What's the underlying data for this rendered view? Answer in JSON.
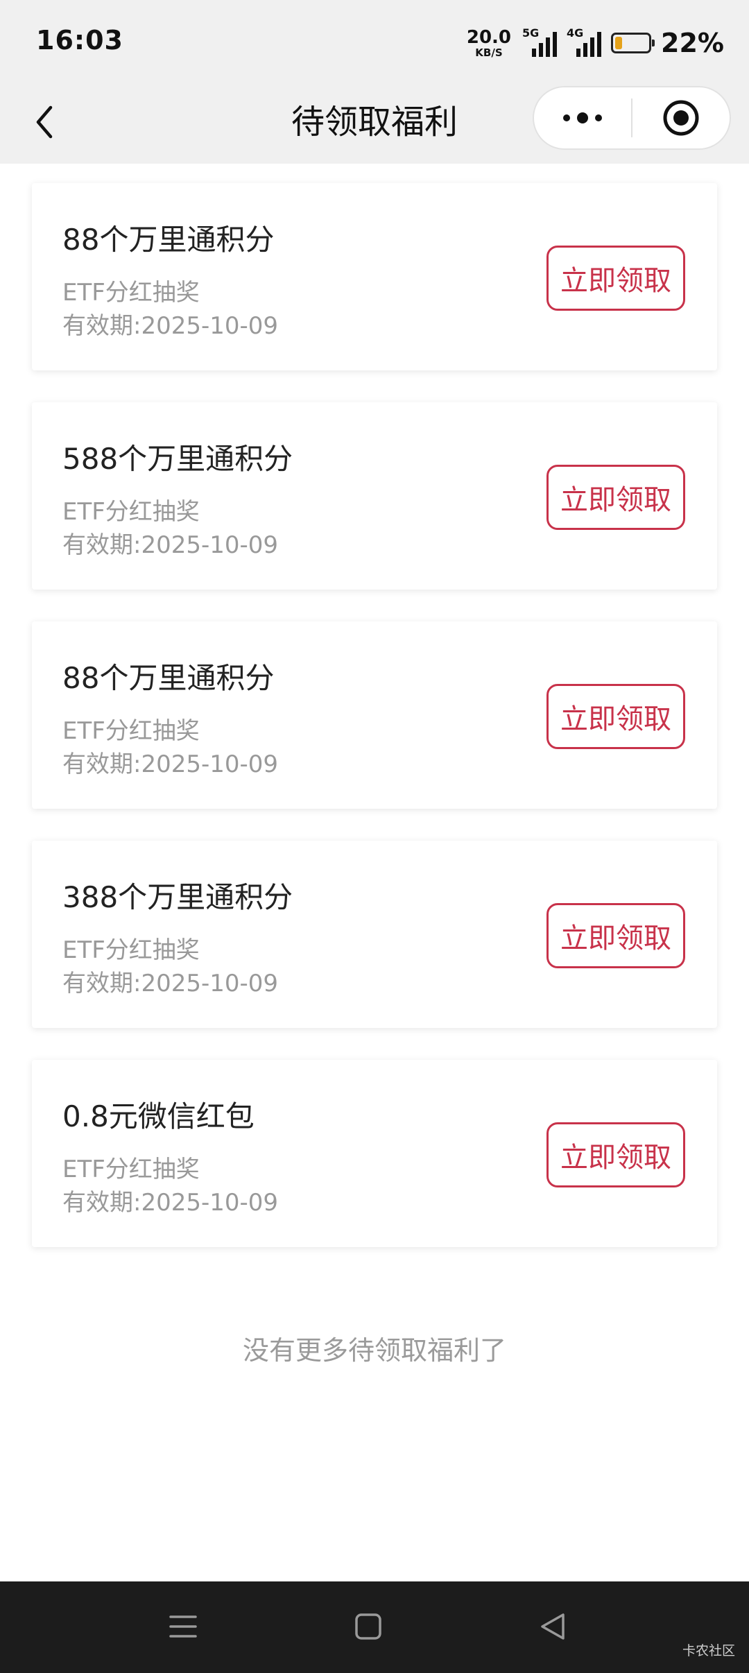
{
  "status_bar": {
    "time": "16:03",
    "net_speed_value": "20.0",
    "net_speed_unit": "KB/S",
    "signal1_label": "5G",
    "signal2_label": "4G",
    "battery_level": 0.22,
    "battery_text": "22%"
  },
  "header": {
    "title": "待领取福利",
    "more_icon": "more-dots-icon",
    "close_icon": "target-circle-icon"
  },
  "rewards": [
    {
      "title": "88个万里通积分",
      "source": "ETF分红抽奖",
      "validity": "有效期:2025-10-09",
      "button": "立即领取"
    },
    {
      "title": "588个万里通积分",
      "source": "ETF分红抽奖",
      "validity": "有效期:2025-10-09",
      "button": "立即领取"
    },
    {
      "title": "88个万里通积分",
      "source": "ETF分红抽奖",
      "validity": "有效期:2025-10-09",
      "button": "立即领取"
    },
    {
      "title": "388个万里通积分",
      "source": "ETF分红抽奖",
      "validity": "有效期:2025-10-09",
      "button": "立即领取"
    },
    {
      "title": "0.8元微信红包",
      "source": "ETF分红抽奖",
      "validity": "有效期:2025-10-09",
      "button": "立即领取"
    }
  ],
  "end_note": "没有更多待领取福利了",
  "nav": {
    "menu_icon": "menu-icon",
    "home_icon": "home-square-icon",
    "back_icon": "back-triangle-icon"
  },
  "watermark": "卡农社区",
  "colors": {
    "accent": "#c8324a",
    "header_bg": "#f0f0f0",
    "nav_bg": "#1c1c1c",
    "battery": "#e5a21a"
  }
}
